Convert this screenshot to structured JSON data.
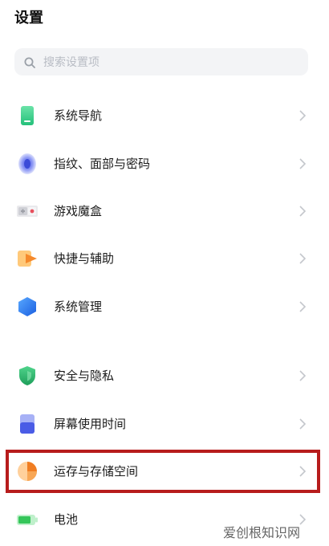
{
  "header": {
    "title": "设置"
  },
  "search": {
    "placeholder": "搜索设置项"
  },
  "items": [
    {
      "label": "系统导航",
      "icon": "phone-navigation-icon",
      "color": "#3ccf8e"
    },
    {
      "label": "指纹、面部与密码",
      "icon": "fingerprint-icon",
      "color": "#5b6cf0"
    },
    {
      "label": "游戏魔盒",
      "icon": "game-box-icon",
      "color": "#e7505d"
    },
    {
      "label": "快捷与辅助",
      "icon": "shortcut-icon",
      "color": "#f7a23b"
    },
    {
      "label": "系统管理",
      "icon": "system-hexagon-icon",
      "color": "#2d7ff9"
    },
    {
      "label": "安全与隐私",
      "icon": "shield-icon",
      "color": "#27b36a"
    },
    {
      "label": "屏幕使用时间",
      "icon": "screen-time-icon",
      "color": "#5063e8"
    },
    {
      "label": "运存与存储空间",
      "icon": "storage-pie-icon",
      "color": "#f59a3c"
    },
    {
      "label": "电池",
      "icon": "battery-icon",
      "color": "#3ecb62"
    }
  ],
  "watermark": {
    "text": "爱创根知识网"
  },
  "highlight_color": "#b71c1c"
}
